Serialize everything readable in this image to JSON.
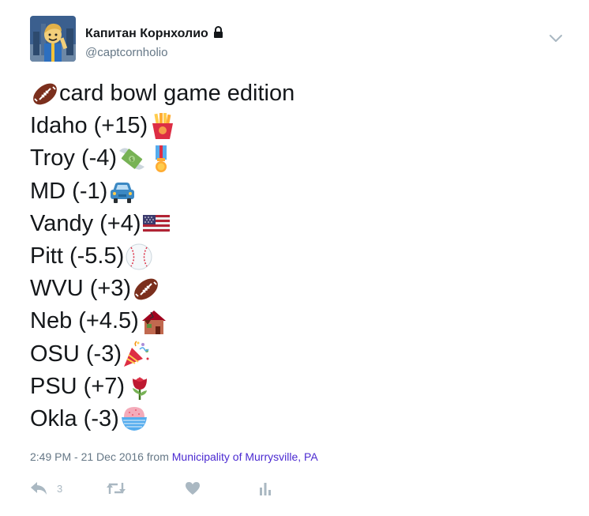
{
  "user": {
    "display_name": "Капитан Корнхолио",
    "handle": "@captcornholio",
    "avatar_icon": "vault-boy-avatar",
    "protected_icon": "lock-icon"
  },
  "tweet": {
    "lines": [
      {
        "text": "card bowl game edition",
        "emoji_before": "american-football-icon"
      },
      {
        "text": "Idaho (+15)",
        "emoji_after": [
          "french-fries-icon"
        ]
      },
      {
        "text": "Troy (-4)",
        "emoji_after": [
          "money-with-wings-icon",
          "military-medal-icon"
        ]
      },
      {
        "text": "MD (-1)",
        "emoji_after": [
          "car-icon"
        ]
      },
      {
        "text": "Vandy (+4)",
        "emoji_after": [
          "us-flag-icon"
        ]
      },
      {
        "text": "Pitt (-5.5)",
        "emoji_after": [
          "baseball-icon"
        ]
      },
      {
        "text": "WVU (+3)",
        "emoji_after": [
          "american-football-icon"
        ]
      },
      {
        "text": "Neb (+4.5)",
        "emoji_after": [
          "derelict-house-icon"
        ]
      },
      {
        "text": "OSU (-3)",
        "emoji_after": [
          "party-popper-icon"
        ]
      },
      {
        "text": "PSU (+7)",
        "emoji_after": [
          "rose-icon"
        ]
      },
      {
        "text": "Okla (-3)",
        "emoji_after": [
          "shaved-ice-icon"
        ]
      }
    ],
    "timestamp": "2:49 PM - 21 Dec 2016",
    "from_label": "from",
    "location": "Municipality of Murrysville, PA"
  },
  "actions": {
    "reply_count": "3",
    "retweet_count": "",
    "like_count": ""
  },
  "colors": {
    "text": "#14171a",
    "secondary": "#657786",
    "link": "#4b2ad1",
    "action_icon": "#aab8c2"
  }
}
